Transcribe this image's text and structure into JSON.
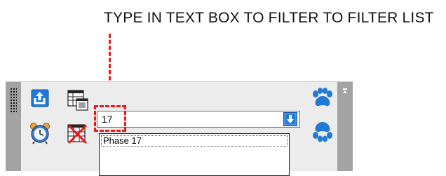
{
  "annotation": {
    "text": "TYPE IN TEXT BOX TO FILTER TO FILTER LIST",
    "color": "#e8191c"
  },
  "toolbar": {
    "icons": [
      "export-icon",
      "window-view-icon",
      "alarm-clock-icon",
      "grid-delete-icon",
      "paw-icon",
      "paw-icon"
    ]
  },
  "filter": {
    "value": "17",
    "dropdown_icon": "down-arrow-icon"
  },
  "list": {
    "items": [
      "Phase 17"
    ]
  },
  "colors": {
    "accent_blue": "#1f7bd6",
    "panel_bg": "#ececec",
    "grip": "#a3a3a3"
  }
}
